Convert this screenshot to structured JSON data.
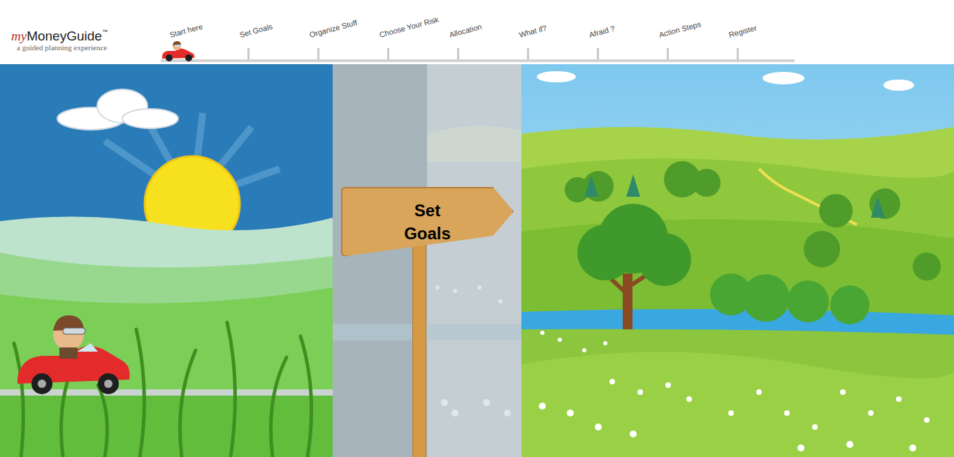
{
  "logo": {
    "prefix": "my",
    "name": "MoneyGuide",
    "mark": "™",
    "tagline": "a guided planning experience"
  },
  "steps": [
    {
      "label": "Start here",
      "selected": true
    },
    {
      "label": "Set Goals",
      "selected": false
    },
    {
      "label": "Organize Stuff",
      "selected": false
    },
    {
      "label": "Choose Your Risk",
      "selected": false
    },
    {
      "label": "Allocation",
      "selected": false
    },
    {
      "label": "What if?",
      "selected": false
    },
    {
      "label": "Afraid ?",
      "selected": false
    },
    {
      "label": "Action Steps",
      "selected": false
    },
    {
      "label": "Register",
      "selected": false
    }
  ],
  "sign": {
    "text": "Set Goals"
  }
}
